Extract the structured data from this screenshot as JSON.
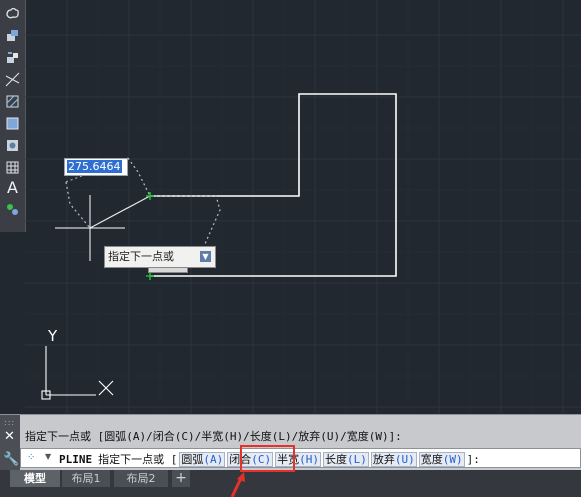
{
  "toolbar": {
    "tools": [
      "revcloud-icon",
      "insert-block-icon",
      "make-block-icon",
      "construction-line-icon",
      "hatch-icon",
      "region-icon",
      "table-icon",
      "multiline-text-icon",
      "add-selected-icon"
    ]
  },
  "dynamic_input": {
    "value": "275.6464"
  },
  "prompt_tooltip": {
    "text": "指定下一点或"
  },
  "command": {
    "history": "指定下一点或 [圆弧(A)/闭合(C)/半宽(H)/长度(L)/放弃(U)/宽度(W)]:",
    "prefix": "PLINE",
    "prompt": "指定下一点或 [",
    "options": [
      {
        "name": "圆弧",
        "key": "(A)"
      },
      {
        "name": "闭合",
        "key": "(C)"
      },
      {
        "name": "半宽",
        "key": "(H)"
      },
      {
        "name": "长度",
        "key": "(L)"
      },
      {
        "name": "放弃",
        "key": "(U)"
      },
      {
        "name": "宽度",
        "key": "(W)"
      }
    ],
    "suffix": "]:"
  },
  "ucs": {
    "y_label": "Y",
    "x_label": "X"
  },
  "tabs": [
    {
      "label": "模型",
      "active": true
    },
    {
      "label": "布局1",
      "active": false
    },
    {
      "label": "布局2",
      "active": false
    }
  ],
  "tab_add_label": "+",
  "colors": {
    "canvas": "#212830",
    "highlight": "#e6312b",
    "polyline": "#ffffff",
    "snap": "#22c33a"
  }
}
